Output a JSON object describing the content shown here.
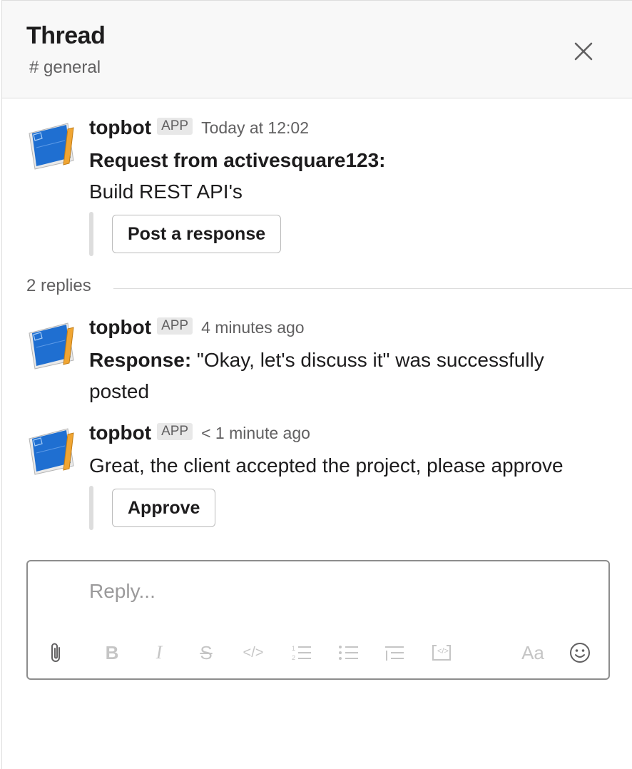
{
  "header": {
    "title": "Thread",
    "channel": "# general"
  },
  "messages": [
    {
      "author": "topbot",
      "badge": "APP",
      "time": "Today at 12:02",
      "bold": "Request from activesquare123:",
      "text": "Build REST API's",
      "button": "Post a response"
    },
    {
      "author": "topbot",
      "badge": "APP",
      "time": "4 minutes ago",
      "bold": "Response:",
      "text": " \"Okay, let's discuss it\" was successfully posted"
    },
    {
      "author": "topbot",
      "badge": "APP",
      "time": "< 1 minute ago",
      "text": "Great, the client accepted the project, please approve",
      "button": "Approve"
    }
  ],
  "replies_label": "2 replies",
  "composer": {
    "placeholder": "Reply...",
    "format_toggle": "Aa",
    "tools": [
      "attach-icon",
      "bold-icon",
      "italic-icon",
      "strikethrough-icon",
      "code-icon",
      "numbered-list-icon",
      "bulleted-list-icon",
      "quote-icon",
      "code-block-icon",
      "format-toggle",
      "emoji-icon"
    ]
  }
}
